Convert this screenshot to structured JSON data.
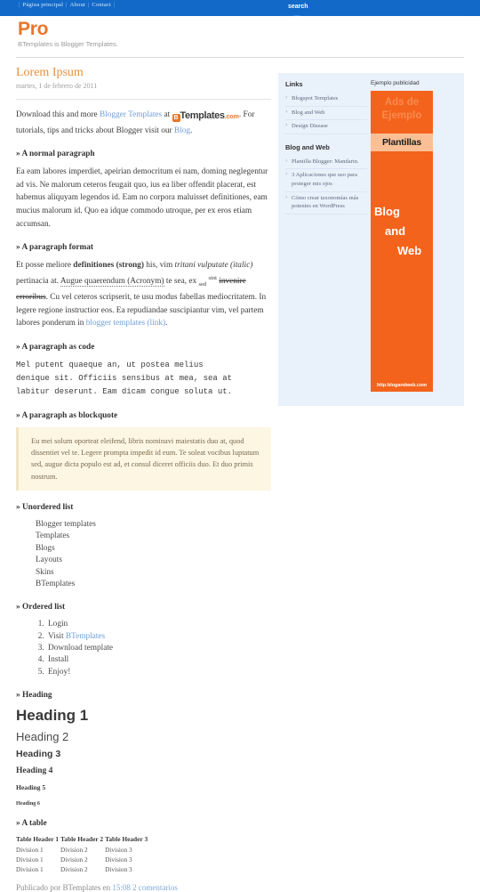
{
  "topnav": {
    "items": [
      "Página principal",
      "About",
      "Contact"
    ],
    "separator": "|"
  },
  "header": {
    "blog_title": "Pro",
    "blog_description": "BTemplates is Blogger Templates."
  },
  "search": {
    "label": "search",
    "value": "",
    "placeholder": "",
    "icon": "search-icon"
  },
  "post": {
    "title": "Lorem Ipsum",
    "date": "martes, 1 de febrero de 2011",
    "intro": {
      "lead": "Download this and more ",
      "link1": "Blogger Templates",
      "mid": " at ",
      "logo_b": "B",
      "logo_text": "Templates",
      "logo_com": ".com",
      "tail": ". For tutorials, tips and tricks about Blogger visit our ",
      "link2": "Blog",
      "end": "."
    },
    "sections": {
      "normal_paragraph": "» A normal paragraph",
      "paragraph_format": "» A paragraph format",
      "paragraph_code": "» A paragraph as code",
      "paragraph_blockquote": "» A paragraph as blockquote",
      "unordered_list": "» Unordered list",
      "ordered_list": "» Ordered list",
      "heading": "» Heading",
      "a_table": "» A table"
    },
    "normal_text": "Ea eam labores imperdiet, apeirian democritum ei nam, doming neglegentur ad vis. Ne malorum ceteros feugait quo, ius ea liber offendit placerat, est habemus aliquyam legendos id. Eam no corpora maluisset definitiones, eam mucius malorum id. Quo ea idque commodo utroque, per ex eros etiam accumsan.",
    "format_paragraph": {
      "t1": "Et posse meliore ",
      "strong": "definitiones (strong)",
      "t2": " his, vim ",
      "italic": "tritani vulputate (italic)",
      "t3": " pertinacia at. ",
      "acronym": "Augue quaerendum (Acronym)",
      "t4": " te sea, ex ",
      "sub": "sed",
      "t5": " ",
      "sup": "sint",
      "t6": " ",
      "strike": "invenire erroribus",
      "t7": ". Cu vel ceteros scripserit, te usu modus fabellas mediocritatem. In legere regione instructior eos. Ea repudiandae suscipiantur vim, vel partem labores ponderum in ",
      "link": "blogger templates (link)",
      "t8": "."
    },
    "code_text": "Mel putent quaeque an, ut postea melius\ndenique sit. Officiis sensibus at mea, sea at\nlabitur deserunt. Eam dicam congue soluta ut.",
    "blockquote_text": "Eu mei solum oporteat eleifend, libris nominavi maiestatis duo at, quod dissentiet vel te. Legere prompta impedit id eum. Te soleat vocibus luptatum sed, augue dicta populo est ad, et consul diceret officiis duo. Et duo primis nostrum.",
    "unordered_items": [
      "Blogger templates",
      "Templates",
      "Blogs",
      "Layouts",
      "Skins",
      "BTemplates"
    ],
    "ordered_items": [
      {
        "text": "Login",
        "link": ""
      },
      {
        "text": "Visit ",
        "link": "BTemplates"
      },
      {
        "text": "Download template",
        "link": ""
      },
      {
        "text": "Install",
        "link": ""
      },
      {
        "text": "Enjoy!",
        "link": ""
      }
    ],
    "headings": {
      "h1": "Heading 1",
      "h2": "Heading 2",
      "h3": "Heading 3",
      "h4": "Heading 4",
      "h5": "Heading 5",
      "h6": "Heading 6"
    },
    "table": {
      "headers": [
        "Table Header 1",
        "Table Header 2",
        "Table Header 3"
      ],
      "rows": [
        [
          "Division 1",
          "Division 2",
          "Division 3"
        ],
        [
          "Division 1",
          "Division 2",
          "Division 3"
        ],
        [
          "Division 1",
          "Division 2",
          "Division 3"
        ]
      ]
    },
    "footer": {
      "prefix": "Publicado por BTemplates en ",
      "time": "15:08",
      "space": " ",
      "comments": "2 comentarios"
    }
  },
  "sidebar": {
    "links_widget": {
      "title": "Links",
      "items": [
        "Blogspot Templates",
        "Blog and Web",
        "Design Disease"
      ]
    },
    "feed_widget": {
      "title": "Blog and Web",
      "items": [
        "Plantilla Blogger: Mandarin.",
        "3 Aplicaciones que uso para proteger mis ojos",
        "Cómo crear taxonomías más potentes en WordPress"
      ]
    },
    "ad_widget": {
      "title": "Ejemplo publicidad",
      "ad_top": "Ads de Ejemplo",
      "ad_strip": "Plantillas",
      "word1": "Blog",
      "word2": "and",
      "word3": "Web",
      "url": "http:blogandweb.com"
    }
  },
  "colors": {
    "brand_orange": "#e8762c",
    "topbar_blue": "#1269c8",
    "search_blue": "#2f86e4",
    "sidebar_bg": "#e9f1fb",
    "ad_orange": "#f4631c",
    "link_blue": "#6f9fd8"
  }
}
